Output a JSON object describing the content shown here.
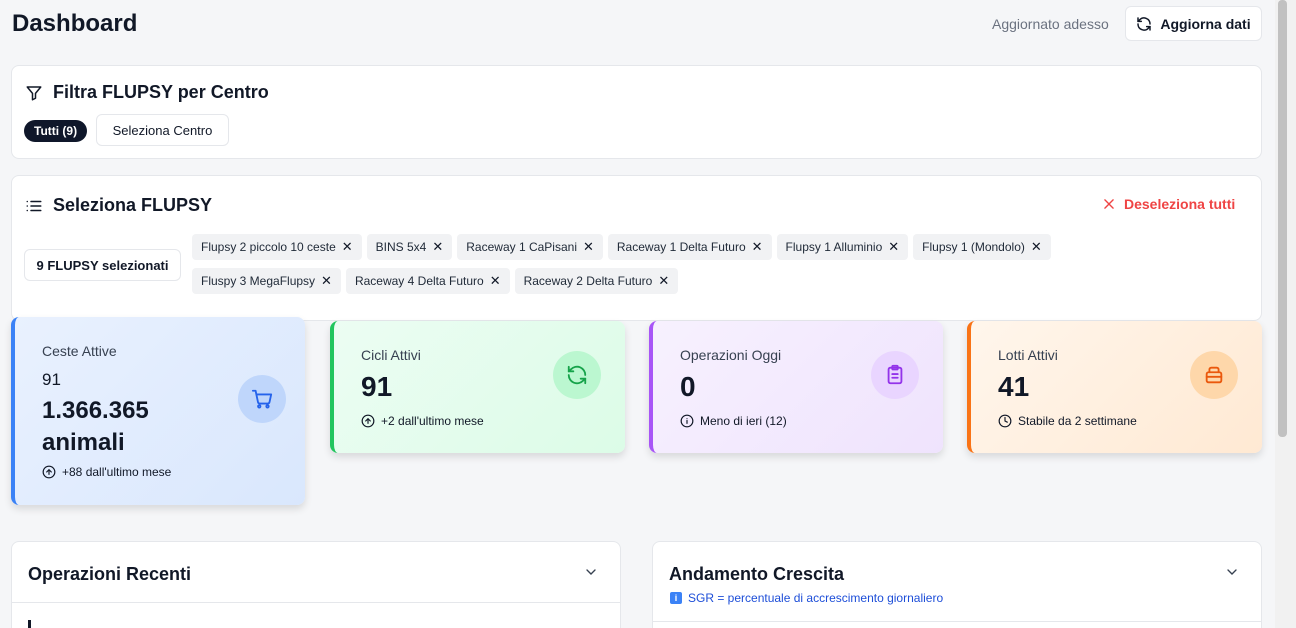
{
  "header": {
    "title": "Dashboard",
    "updated_text": "Aggiornato adesso",
    "refresh_label": "Aggiorna dati"
  },
  "filter": {
    "title": "Filtra FLUPSY per Centro",
    "all_label": "Tutti (9)",
    "select_center_label": "Seleziona Centro"
  },
  "selection": {
    "title": "Seleziona FLUPSY",
    "deselect_label": "Deseleziona tutti",
    "count_label": "9 FLUPSY selezionati",
    "chips": [
      "Flupsy 2 piccolo 10 ceste",
      "BINS 5x4",
      "Raceway 1 CaPisani",
      "Raceway 1 Delta Futuro",
      "Flupsy 1 Alluminio",
      "Flupsy 1 (Mondolo)",
      "Fluspy 3 MegaFlupsy",
      "Raceway 4 Delta Futuro",
      "Raceway 2 Delta Futuro"
    ],
    "chip_close": "✕"
  },
  "stats": {
    "baskets": {
      "label": "Ceste Attive",
      "count": "91",
      "animals_line1": "1.366.365",
      "animals_line2": "animali",
      "foot": "+88 dall'ultimo mese",
      "icon": "cart-icon",
      "color": "#3b82f6"
    },
    "cycles": {
      "label": "Cicli Attivi",
      "value": "91",
      "foot": "+2 dall'ultimo mese",
      "icon": "refresh-icon",
      "color": "#22c55e"
    },
    "operations": {
      "label": "Operazioni Oggi",
      "value": "0",
      "foot": "Meno di ieri (12)",
      "icon": "clipboard-icon",
      "color": "#a855f7"
    },
    "lots": {
      "label": "Lotti Attivi",
      "value": "41",
      "foot": "Stabile da 2 settimane",
      "icon": "box-icon",
      "color": "#f97316"
    }
  },
  "panels": {
    "recent_ops_title": "Operazioni Recenti",
    "growth_title": "Andamento Crescita",
    "sgr_note": "SGR = percentuale di accrescimento giornaliero",
    "info_glyph": "i"
  }
}
